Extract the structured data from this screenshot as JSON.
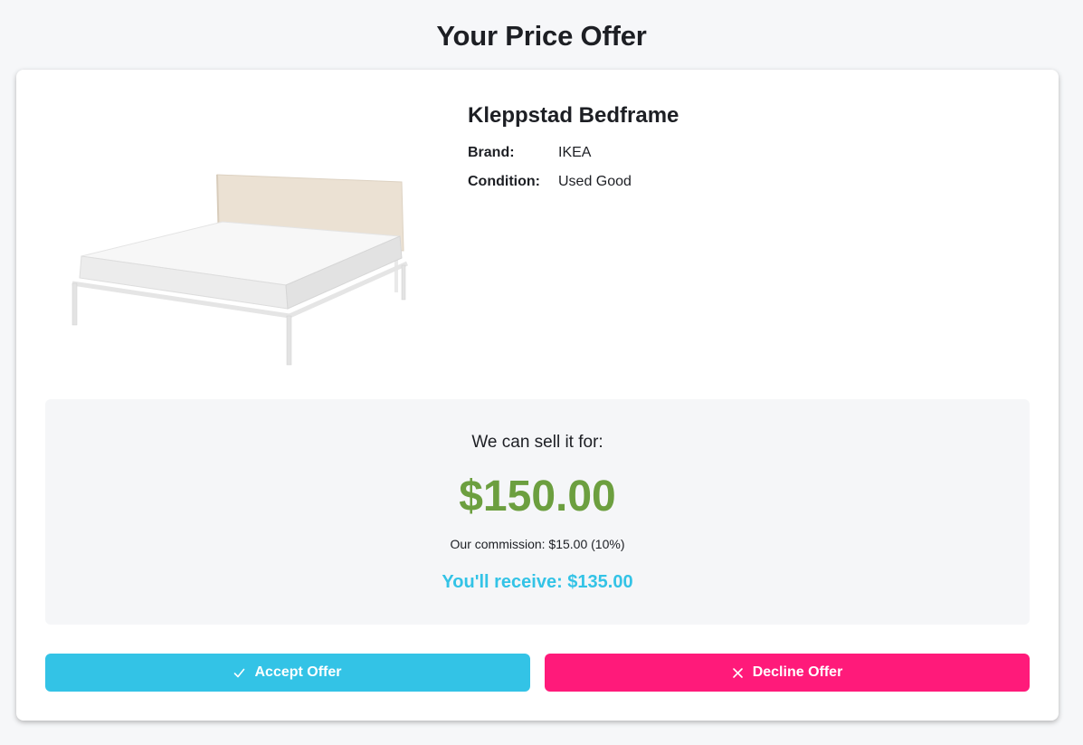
{
  "page": {
    "title": "Your Price Offer"
  },
  "product": {
    "name": "Kleppstad Bedframe",
    "image_icon": "bed-frame-image",
    "details": [
      {
        "label": "Brand:",
        "value": "IKEA"
      },
      {
        "label": "Condition:",
        "value": "Used Good"
      }
    ]
  },
  "offer": {
    "intro": "We can sell it for:",
    "price": "$150.00",
    "commission": "Our commission: $15.00 (10%)",
    "receive": "You'll receive: $135.00"
  },
  "actions": {
    "accept_label": "Accept Offer",
    "accept_icon": "check-icon",
    "decline_label": "Decline Offer",
    "decline_icon": "close-icon"
  },
  "colors": {
    "price_green": "#6c9f3f",
    "accent_cyan": "#33c3e6",
    "decline_pink": "#ff1a7a"
  }
}
